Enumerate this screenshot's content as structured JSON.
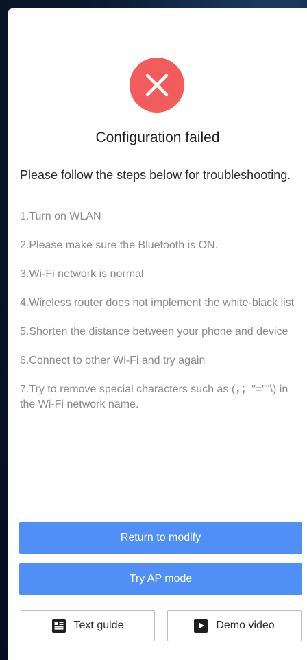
{
  "dialog": {
    "title": "Configuration failed",
    "intro": "Please follow the steps below for troubleshooting.",
    "status_icon": "close-icon",
    "status_color": "#f25c5c"
  },
  "steps": [
    "1.Turn on WLAN",
    "2.Please make sure the Bluetooth is ON.",
    "3.Wi-Fi network is normal",
    "4.Wireless router does not implement the white-black list",
    "5.Shorten the distance between your phone and device",
    "6.Connect to other Wi-Fi and try again",
    "7.Try to remove special characters such as (，；\"=\"\"\\) in the Wi-Fi network name."
  ],
  "actions": {
    "return_label": "Return to modify",
    "ap_mode_label": "Try AP mode",
    "text_guide_label": "Text guide",
    "text_guide_icon": "document-icon",
    "demo_video_label": "Demo video",
    "demo_video_icon": "play-icon",
    "primary_color": "#4f8ff6"
  }
}
